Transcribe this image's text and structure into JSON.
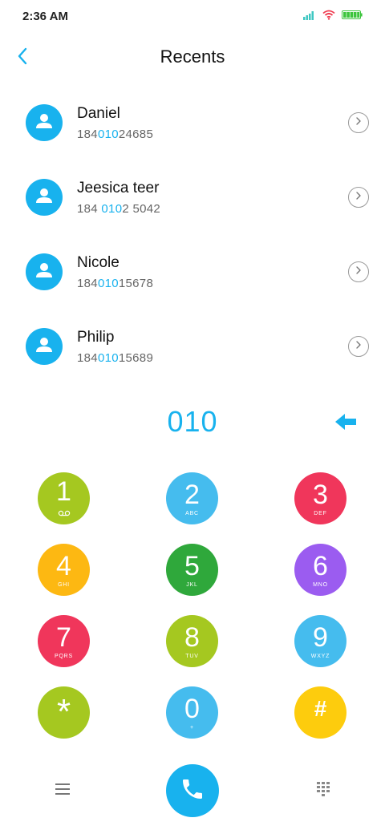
{
  "status_bar": {
    "time": "2:36 AM",
    "icons": [
      "signal-icon",
      "wifi-icon",
      "battery-icon"
    ]
  },
  "header": {
    "title": "Recents",
    "back_icon": "chevron-left-icon"
  },
  "recents": [
    {
      "name": "Daniel",
      "number_parts": [
        "184",
        "010",
        "24685"
      ]
    },
    {
      "name": "Jeesica teer",
      "number_parts": [
        "184 ",
        "010",
        "2 5042"
      ]
    },
    {
      "name": "Nicole",
      "number_parts": [
        "184",
        "010",
        "15678"
      ]
    },
    {
      "name": "Philip",
      "number_parts": [
        "184",
        "010",
        "15689"
      ]
    }
  ],
  "dialer": {
    "dialed_number": "010",
    "keys": [
      {
        "digit": "1",
        "letters": "",
        "color": "#a5c820"
      },
      {
        "digit": "2",
        "letters": "ABC",
        "color": "#45bcee"
      },
      {
        "digit": "3",
        "letters": "DEF",
        "color": "#f0365b"
      },
      {
        "digit": "4",
        "letters": "GHI",
        "color": "#fdb812"
      },
      {
        "digit": "5",
        "letters": "JKL",
        "color": "#2fa83b"
      },
      {
        "digit": "6",
        "letters": "MNO",
        "color": "#9b5cf0"
      },
      {
        "digit": "7",
        "letters": "PQRS",
        "color": "#f0365b"
      },
      {
        "digit": "8",
        "letters": "TUV",
        "color": "#a5c820"
      },
      {
        "digit": "9",
        "letters": "WXYZ",
        "color": "#45bcee"
      },
      {
        "digit": "*",
        "letters": "",
        "color": "#a5c820"
      },
      {
        "digit": "0",
        "letters": "+",
        "color": "#45bcee"
      },
      {
        "digit": "#",
        "letters": "",
        "color": "#fdcc0d"
      }
    ]
  },
  "colors": {
    "accent": "#18b2ee",
    "text_primary": "#111111",
    "text_secondary": "#666666"
  }
}
